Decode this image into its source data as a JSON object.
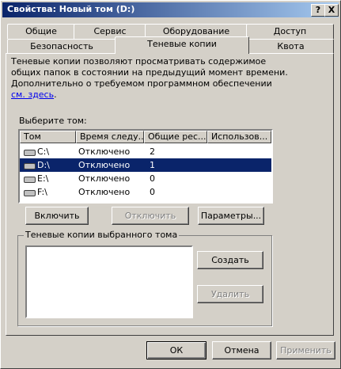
{
  "window": {
    "title": "Свойства: Новый том (D:)",
    "help_label": "?",
    "close_label": "X"
  },
  "tabs": {
    "row1": [
      "Общие",
      "Сервис",
      "Оборудование",
      "Доступ"
    ],
    "row2": [
      "Безопасность",
      "Теневые копии",
      "Квота"
    ],
    "active": "Теневые копии"
  },
  "description": {
    "text": "Теневые копии позволяют просматривать содержимое общих папок в состоянии на предыдущий момент времени. Дополнительно о требуемом программном обеспечении ",
    "link": "см. здесь",
    "end": "."
  },
  "volumes": {
    "label": "Выберите том:",
    "columns": [
      "Том",
      "Время следу...",
      "Общие рес...",
      "Использов..."
    ],
    "rows": [
      {
        "volume": "C:\\",
        "next_time": "Отключено",
        "shares": "2",
        "used": "",
        "selected": false
      },
      {
        "volume": "D:\\",
        "next_time": "Отключено",
        "shares": "1",
        "used": "",
        "selected": true
      },
      {
        "volume": "E:\\",
        "next_time": "Отключено",
        "shares": "0",
        "used": "",
        "selected": false
      },
      {
        "volume": "F:\\",
        "next_time": "Отключено",
        "shares": "0",
        "used": "",
        "selected": false
      }
    ]
  },
  "buttons": {
    "enable": "Включить",
    "disable": "Отключить",
    "settings": "Параметры...",
    "create": "Создать",
    "delete": "Удалить",
    "ok": "ОК",
    "cancel": "Отмена",
    "apply": "Применить"
  },
  "snapshots_group": {
    "label": "Теневые копии выбранного тома"
  }
}
